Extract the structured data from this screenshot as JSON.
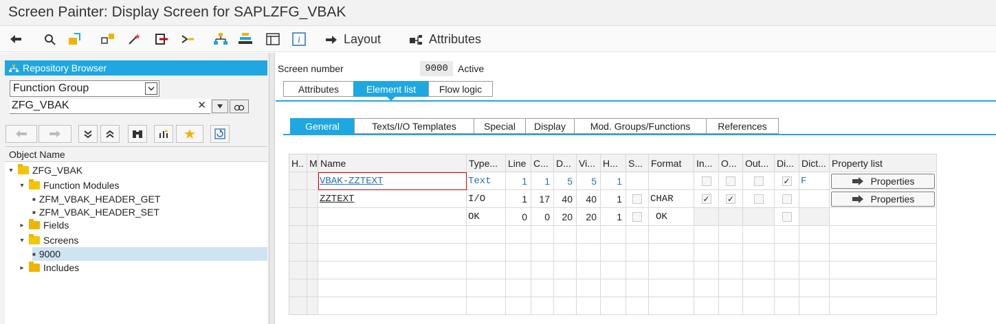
{
  "window": {
    "title": "Screen Painter: Display Screen for SAPLZFG_VBAK"
  },
  "toolbar": {
    "icons": [
      "back-icon",
      "other-object-icon",
      "display-change-icon",
      "activate-icon",
      "magic-wand-icon",
      "where-used-icon",
      "navigate-icon",
      "hierarchy-icon",
      "stack-icon",
      "screen-icon",
      "info-icon"
    ],
    "layout_label": "Layout",
    "attributes_label": "Attributes"
  },
  "repository": {
    "title": "Repository Browser",
    "object_type": "Function Group",
    "object_name_value": "ZFG_VBAK",
    "tree_header": "Object Name",
    "tree": [
      {
        "label": "ZFG_VBAK",
        "level": 0,
        "type": "folder-open"
      },
      {
        "label": "Function Modules",
        "level": 1,
        "type": "folder-open"
      },
      {
        "label": "ZFM_VBAK_HEADER_GET",
        "level": 2,
        "type": "leaf"
      },
      {
        "label": "ZFM_VBAK_HEADER_SET",
        "level": 2,
        "type": "leaf"
      },
      {
        "label": "Fields",
        "level": 1,
        "type": "folder"
      },
      {
        "label": "Screens",
        "level": 1,
        "type": "folder-open"
      },
      {
        "label": "9000",
        "level": 2,
        "type": "leaf",
        "selected": true
      },
      {
        "label": "Includes",
        "level": 1,
        "type": "folder"
      }
    ]
  },
  "screen": {
    "number_label": "Screen number",
    "number_value": "9000",
    "status": "Active"
  },
  "main_tabs": [
    "Attributes",
    "Element list",
    "Flow logic"
  ],
  "sub_tabs": [
    "General",
    "Texts/I/O Templates",
    "Special",
    "Display",
    "Mod. Groups/Functions",
    "References"
  ],
  "table": {
    "columns": [
      "H..",
      "M",
      "Name",
      "Type...",
      "Line",
      "C...",
      "D...",
      "Vi...",
      "H...",
      "S...",
      "Format",
      "In...",
      "O...",
      "Out...",
      "Di...",
      "Dict...",
      "Property list"
    ],
    "rows": [
      {
        "name": "VBAK-ZZTEXT",
        "type": "Text",
        "line": "1",
        "col": "1",
        "def": "5",
        "vis": "5",
        "height": "1",
        "format": "",
        "input": false,
        "output": false,
        "outonly": false,
        "dict": true,
        "dictflag": "F",
        "property": "Properties"
      },
      {
        "name": "ZZTEXT",
        "type": "I/O",
        "line": "1",
        "col": "17",
        "def": "40",
        "vis": "40",
        "height": "1",
        "format": "CHAR",
        "input": true,
        "output": true,
        "outonly": false,
        "dict": false,
        "dictflag": "",
        "property": "Properties"
      },
      {
        "name": "",
        "type": "OK",
        "line": "0",
        "col": "0",
        "def": "20",
        "vis": "20",
        "height": "1",
        "format": "OK",
        "input": null,
        "output": null,
        "outonly": null,
        "dict": false,
        "dictflag": "",
        "property": ""
      }
    ]
  },
  "colors": {
    "accent": "#1fa7e1",
    "link": "#2b6fb8",
    "folder": "#f0b400"
  }
}
